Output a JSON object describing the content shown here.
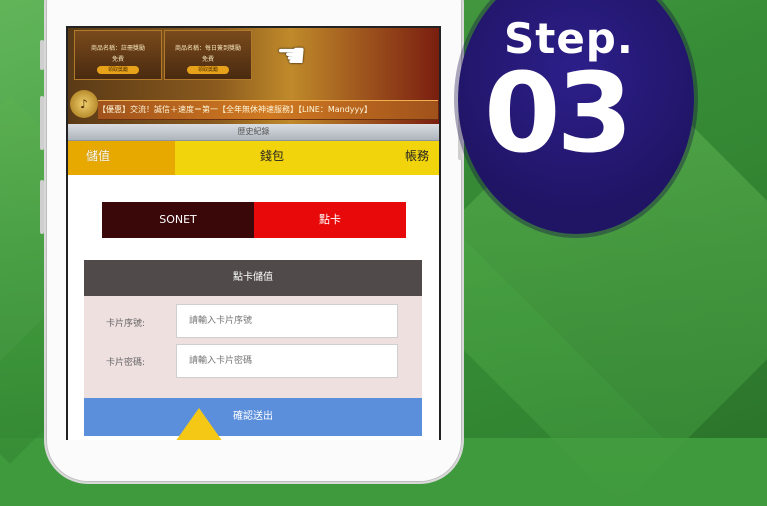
{
  "banner": {
    "card1_title": "商品名稱：註冊獎勵",
    "card1_price": "免費",
    "card1_button": "領取獎勵",
    "card2_title": "商品名稱：每日簽到獎勵",
    "card2_price": "免費",
    "card2_button": "領取獎勵",
    "ticker": "【優惠】交流！誠信＋速度＝第一【全年無休神速服務】【LINE：Mandyyy】",
    "history_label": "歷史紀錄"
  },
  "tabs": [
    "儲值",
    "錢包",
    "帳務"
  ],
  "payment_methods": [
    "SONET",
    "點卡"
  ],
  "form": {
    "title": "點卡儲值",
    "serial_label": "卡片序號:",
    "serial_placeholder": "請輸入卡片序號",
    "password_label": "卡片密碼:",
    "password_placeholder": "請輸入卡片密碼",
    "submit_label": "確認送出"
  },
  "step": {
    "label": "Step.",
    "number": "03"
  },
  "colors": {
    "background": "#3f9a3d",
    "tab_active": "#e7a800",
    "tab_inactive": "#f2d40c",
    "method_sonet": "#3a0808",
    "method_card": "#e8090a",
    "panel_head": "#504a4a",
    "submit": "#5b8fdc",
    "step_circle": "#201465"
  }
}
